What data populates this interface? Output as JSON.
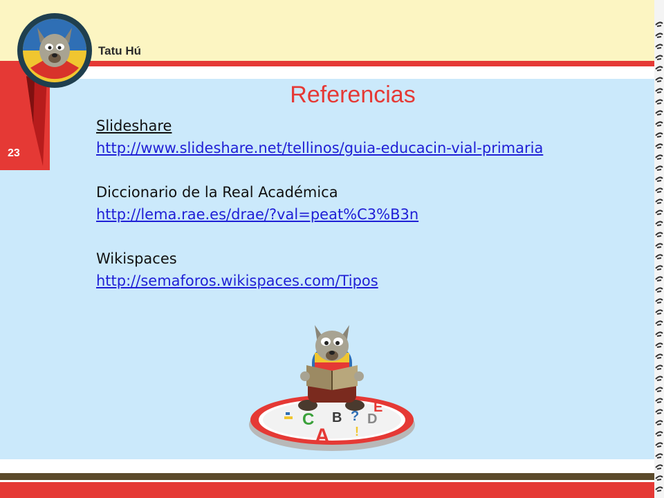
{
  "header": {
    "brand_name": "Tatu Hú"
  },
  "slide": {
    "number": "23",
    "title": "Referencias"
  },
  "references": [
    {
      "name": "Slideshare",
      "url": "http://www.slideshare.net/tellinos/guia-educacin-vial-primaria"
    },
    {
      "name": "Diccionario de la Real Académica",
      "url": "http://lema.rae.es/drae/?val=peat%C3%B3n"
    },
    {
      "name": "Wikispaces",
      "url": "http://semaforos.wikispaces.com/Tipos"
    }
  ],
  "illustration": {
    "letters": [
      "A",
      "B",
      "C",
      "D",
      "E",
      "?",
      "!"
    ]
  },
  "colors": {
    "accent_red": "#e53935",
    "header_cream": "#fcf5c2",
    "content_blue": "#cbe9fb",
    "link_blue": "#1f1fd6",
    "footer_brown": "#5b4a2b"
  }
}
